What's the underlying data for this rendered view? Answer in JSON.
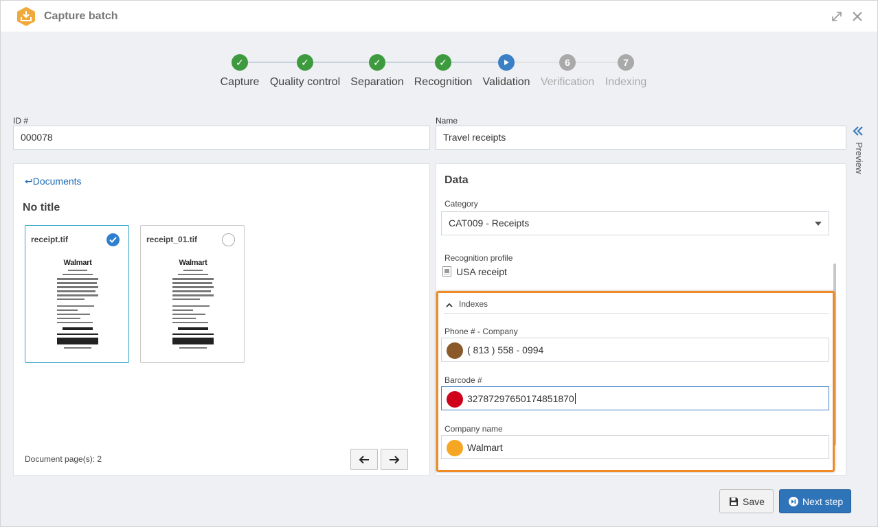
{
  "window": {
    "title": "Capture batch",
    "app_icon": "download-tray-icon",
    "accent": "#f0a93b"
  },
  "stepper": {
    "steps": [
      {
        "label": "Capture",
        "state": "done",
        "number": ""
      },
      {
        "label": "Quality control",
        "state": "done",
        "number": ""
      },
      {
        "label": "Separation",
        "state": "done",
        "number": ""
      },
      {
        "label": "Recognition",
        "state": "done",
        "number": ""
      },
      {
        "label": "Validation",
        "state": "active",
        "number": ""
      },
      {
        "label": "Verification",
        "state": "pending",
        "number": "6"
      },
      {
        "label": "Indexing",
        "state": "pending",
        "number": "7"
      }
    ],
    "colors": {
      "done": "#3e9a3e",
      "active": "#3b7fc4",
      "pending": "#a9a9a9"
    }
  },
  "form": {
    "id_label": "ID #",
    "id_value": "000078",
    "name_label": "Name",
    "name_value": "Travel receipts"
  },
  "preview": {
    "label": "Preview"
  },
  "documents": {
    "back_label": "Documents",
    "title": "No title",
    "files": [
      {
        "name": "receipt.tif",
        "selected": true,
        "logo": "Walmart"
      },
      {
        "name": "receipt_01.tif",
        "selected": false,
        "logo": "Walmart"
      }
    ],
    "page_count": "Document page(s): 2"
  },
  "data_panel": {
    "title": "Data",
    "category_label": "Category",
    "category_value": "CAT009 - Receipts",
    "profile_label": "Recognition profile",
    "profile_value": "USA receipt",
    "indexes_label": "Indexes",
    "highlight_color": "#f08a24",
    "fields": [
      {
        "label": "Phone # - Company",
        "value": "( 813 ) 558 - 0994",
        "color": "#8b5a2b"
      },
      {
        "label": "Barcode #",
        "value": "32787297650174851870",
        "color": "#d0021b"
      },
      {
        "label": "Company name",
        "value": "Walmart",
        "color": "#f5a623"
      }
    ]
  },
  "actions": {
    "save_label": "Save",
    "next_label": "Next step"
  }
}
